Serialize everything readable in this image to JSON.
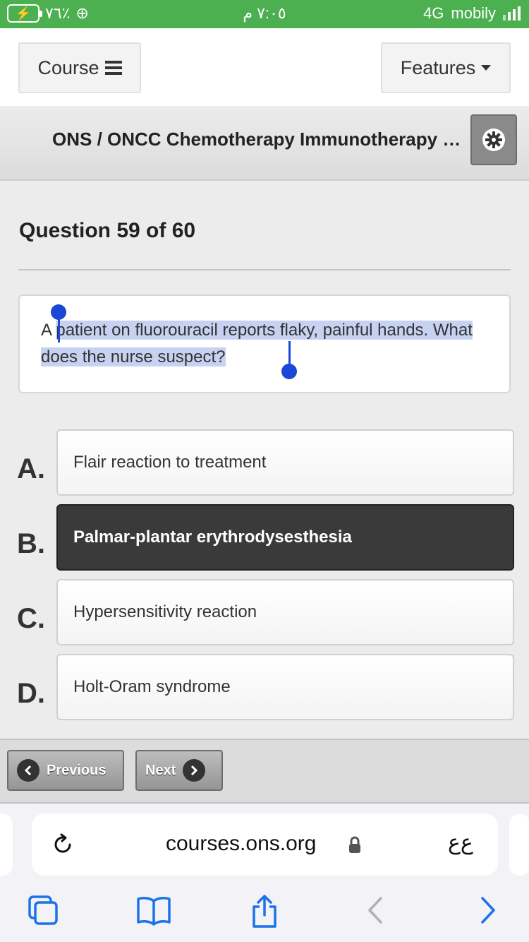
{
  "status_bar": {
    "battery": "٧٦٪",
    "time": "٧:٠٥ م",
    "network": "4G",
    "carrier": "mobily"
  },
  "nav": {
    "course_label": "Course",
    "features_label": "Features"
  },
  "course": {
    "title": "ONS / ONCC Chemotherapy Immunotherapy Certificate Course"
  },
  "quiz": {
    "counter": "Question 59 of 60",
    "question_prefix": "A",
    "question_selected": "patient on fluorouracil reports flaky, painful hands. What does the nurse suspect?",
    "options": [
      {
        "letter": "A.",
        "text": "Flair reaction to treatment"
      },
      {
        "letter": "B.",
        "text": "Palmar-plantar erythrodysesthesia"
      },
      {
        "letter": "C.",
        "text": "Hypersensitivity reaction"
      },
      {
        "letter": "D.",
        "text": "Holt-Oram syndrome"
      }
    ],
    "selected_option": "B."
  },
  "pager": {
    "previous_label": "Previous",
    "next_label": "Next"
  },
  "browser": {
    "url": "courses.ons.org",
    "text_size_label": "ﻉﻉ",
    "icons": [
      "reload-icon",
      "lock-icon",
      "tabs-icon",
      "bookmarks-icon",
      "share-icon",
      "back-icon",
      "forward-icon"
    ]
  },
  "colors": {
    "status_bar": "#4caf50",
    "selected_option": "#3a3a3a",
    "text_selection": "#c7d2f2",
    "selection_handle": "#1a47d6",
    "safari_accent": "#1a73e8"
  }
}
